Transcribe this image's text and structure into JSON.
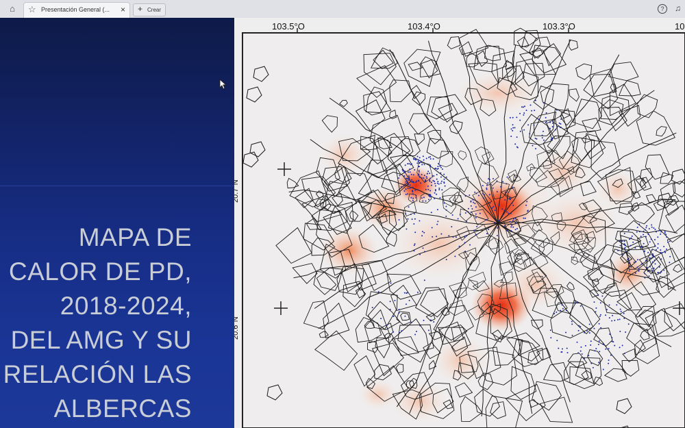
{
  "tabs": {
    "home_icon": "home-icon",
    "active_tab_label": "Presentación General (...",
    "new_tab_label": "Crear",
    "close_glyph": "×",
    "plus_glyph": "+",
    "star_glyph": "☆",
    "help_glyph": "?"
  },
  "slide": {
    "title_lines": [
      "MAPA DE",
      "CALOR DE PD,",
      "2018-2024,",
      "DEL AMG Y SU",
      "RELACIÓN LAS",
      "ALBERCAS"
    ]
  },
  "map": {
    "lon_labels": [
      "103.5°O",
      "103.4°O",
      "103.3°O",
      "10"
    ],
    "lat_labels": [
      "20.7°N",
      "20.6°N"
    ],
    "colors": {
      "hot": "#e8391c",
      "warm": "#f2885a",
      "points": "#1e2aa6",
      "lines": "#1a1a1a"
    }
  }
}
